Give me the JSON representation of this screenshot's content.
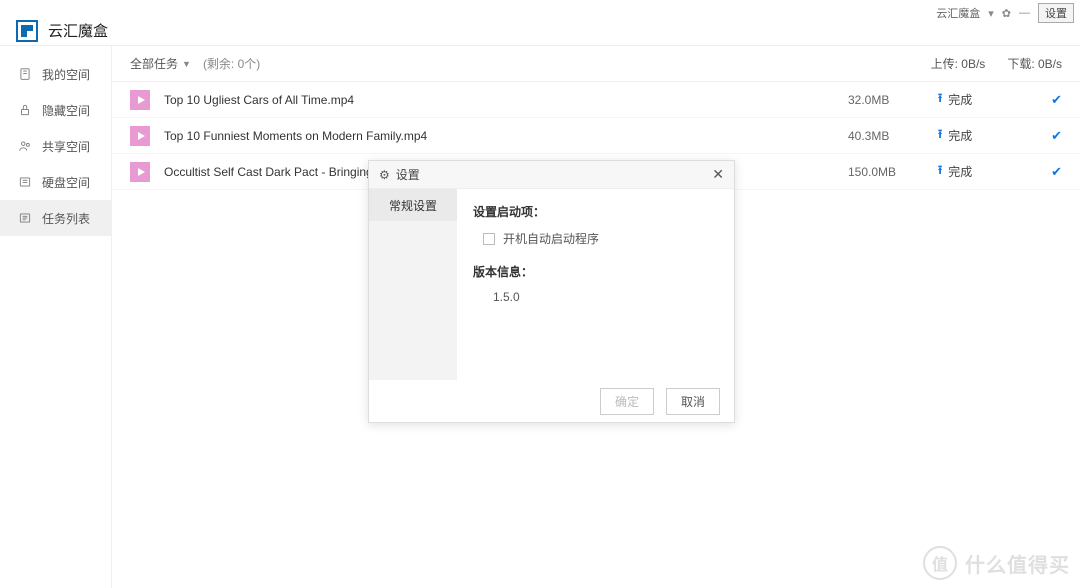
{
  "titlebar": {
    "app_label": "云汇魔盒",
    "settings_btn": "设置"
  },
  "app_title": "云汇魔盒",
  "sidebar": {
    "items": [
      {
        "label": "我的空间"
      },
      {
        "label": "隐藏空间"
      },
      {
        "label": "共享空间"
      },
      {
        "label": "硬盘空间"
      },
      {
        "label": "任务列表"
      }
    ]
  },
  "toolbar": {
    "all_tasks": "全部任务",
    "remaining": "(剩余: 0个)",
    "upload_rate": "上传: 0B/s",
    "download_rate": "下载: 0B/s"
  },
  "rows": [
    {
      "name": "Top 10 Ugliest Cars of All Time.mp4",
      "size": "32.0MB",
      "status": "完成"
    },
    {
      "name": "Top 10 Funniest Moments on Modern Family.mp4",
      "size": "40.3MB",
      "status": "完成"
    },
    {
      "name": "Occultist Self Cast Dark Pact - Bringing in th",
      "size": "150.0MB",
      "status": "完成"
    }
  ],
  "modal": {
    "title": "设置",
    "tab_general": "常规设置",
    "startup_section": "设置启动项：",
    "autostart_label": "开机自动启动程序",
    "version_section": "版本信息：",
    "version_value": "1.5.0",
    "ok": "确定",
    "cancel": "取消"
  },
  "watermark": {
    "circle": "值",
    "text": "什么值得买"
  }
}
